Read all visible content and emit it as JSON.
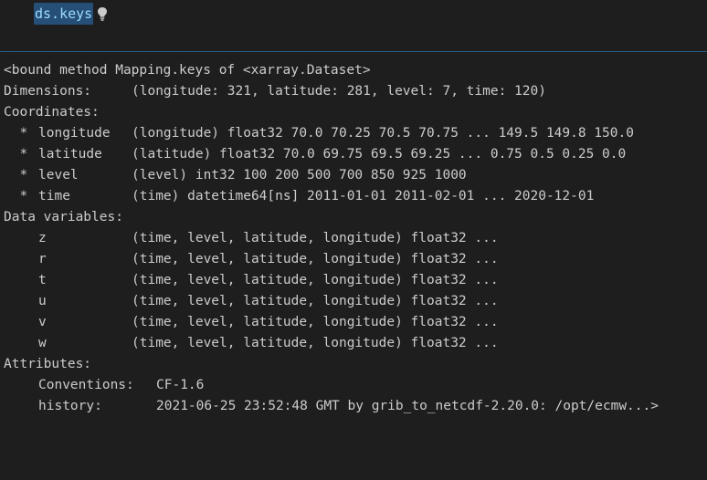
{
  "cell": {
    "code": "ds.keys",
    "hint_icon": "lightbulb-icon"
  },
  "output": {
    "header": "<bound method Mapping.keys of <xarray.Dataset>",
    "dimensions": {
      "label": "Dimensions:",
      "value": "(longitude: 321, latitude: 281, level: 7, time: 120)"
    },
    "coordinates": {
      "label": "Coordinates:",
      "items": [
        {
          "marker": "  *",
          "name": "longitude",
          "value": "(longitude) float32 70.0 70.25 70.5 70.75 ... 149.5 149.8 150.0"
        },
        {
          "marker": "  *",
          "name": "latitude",
          "value": "(latitude) float32 70.0 69.75 69.5 69.25 ... 0.75 0.5 0.25 0.0"
        },
        {
          "marker": "  *",
          "name": "level",
          "value": "(level) int32 100 200 500 700 850 925 1000"
        },
        {
          "marker": "  *",
          "name": "time",
          "value": "(time) datetime64[ns] 2011-01-01 2011-02-01 ... 2020-12-01"
        }
      ]
    },
    "data_variables": {
      "label": "Data variables:",
      "items": [
        {
          "name": "z",
          "value": "(time, level, latitude, longitude) float32 ..."
        },
        {
          "name": "r",
          "value": "(time, level, latitude, longitude) float32 ..."
        },
        {
          "name": "t",
          "value": "(time, level, latitude, longitude) float32 ..."
        },
        {
          "name": "u",
          "value": "(time, level, latitude, longitude) float32 ..."
        },
        {
          "name": "v",
          "value": "(time, level, latitude, longitude) float32 ..."
        },
        {
          "name": "w",
          "value": "(time, level, latitude, longitude) float32 ..."
        }
      ]
    },
    "attributes": {
      "label": "Attributes:",
      "items": [
        {
          "name": "Conventions:",
          "value": "CF-1.6"
        },
        {
          "name": "history:",
          "value": "2021-06-25 23:52:48 GMT by grib_to_netcdf-2.20.0: /opt/ecmw...>"
        }
      ]
    }
  },
  "colors": {
    "background": "#1e1e1e",
    "code_text": "#9cdcfe",
    "selection": "#264f78",
    "output_text": "#cccccc",
    "divider": "#2b5a86",
    "lightbulb": "#d7ba7d"
  }
}
